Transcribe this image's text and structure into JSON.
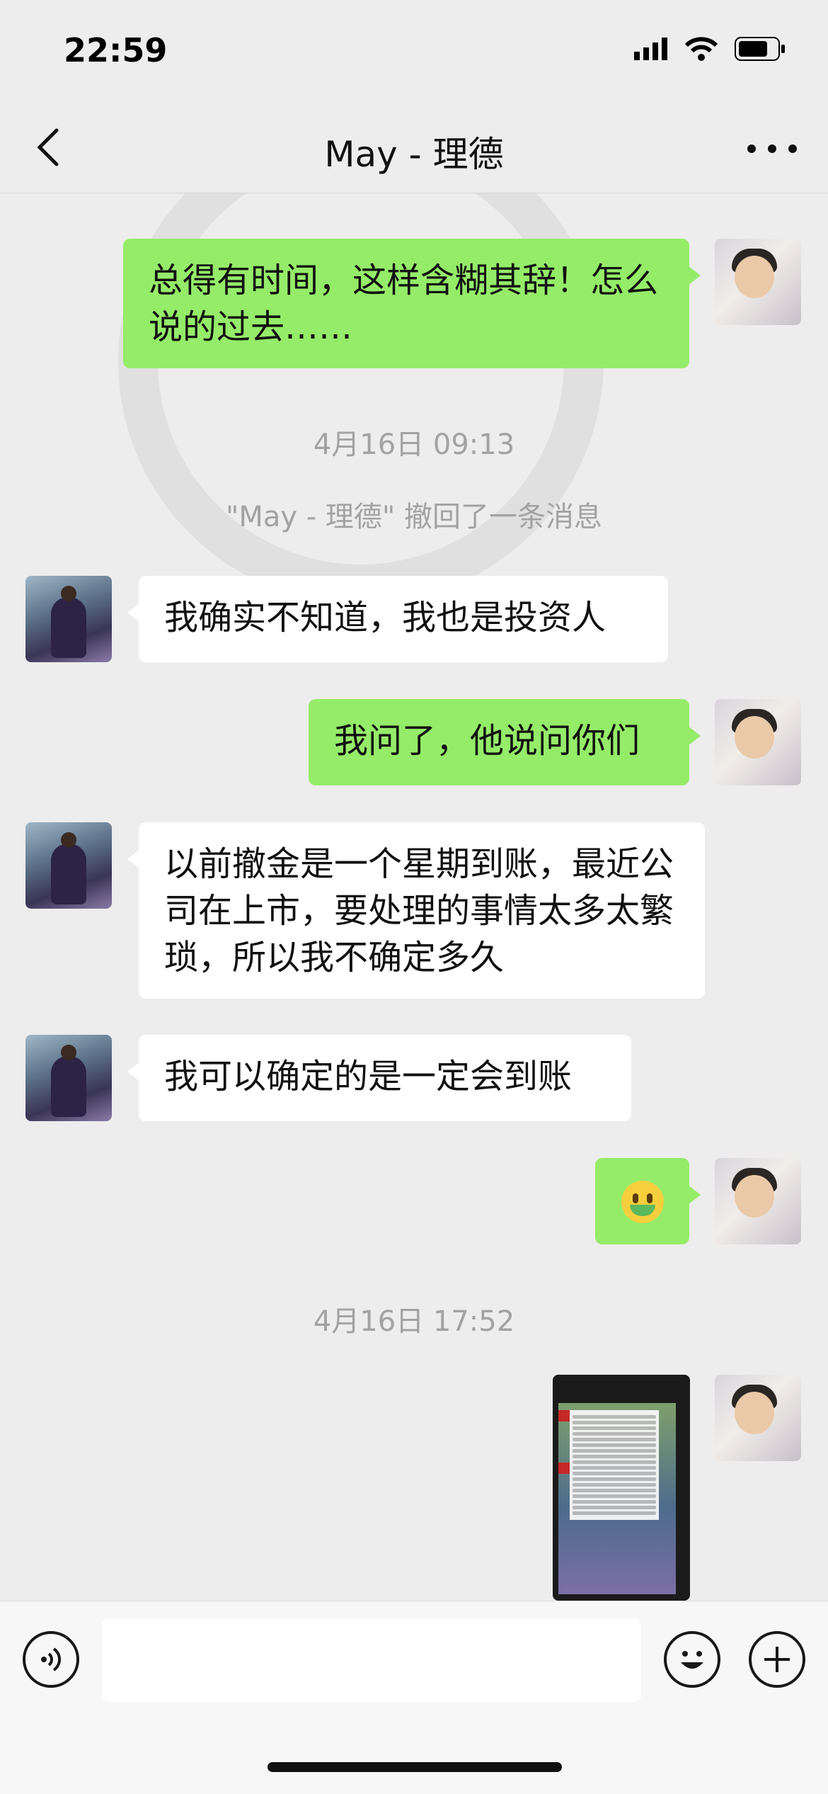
{
  "status_bar": {
    "time": "22:59"
  },
  "header": {
    "title": "May - 理德"
  },
  "messages": [
    {
      "type": "out",
      "text": "总得有时间，这样含糊其辞！怎么说的过去……"
    },
    {
      "type": "timestamp",
      "text": "4月16日 09:13"
    },
    {
      "type": "system",
      "text": "\"May - 理德\" 撤回了一条消息"
    },
    {
      "type": "in",
      "text": "我确实不知道，我也是投资人"
    },
    {
      "type": "out",
      "text": "我问了，他说问你们"
    },
    {
      "type": "in",
      "text": "以前撤金是一个星期到账，最近公司在上市，要处理的事情太多太繁琐，所以我不确定多久"
    },
    {
      "type": "in",
      "text": "我可以确定的是一定会到账"
    },
    {
      "type": "out_emoji",
      "icon": "money-mouth-face-emoji"
    },
    {
      "type": "timestamp",
      "text": "4月16日 17:52"
    },
    {
      "type": "out_image",
      "caption": "screenshot-thumbnail"
    }
  ],
  "input_bar": {
    "placeholder": ""
  },
  "colors": {
    "outgoing_bubble": "#95ec69",
    "incoming_bubble": "#ffffff",
    "background": "#ededed"
  }
}
